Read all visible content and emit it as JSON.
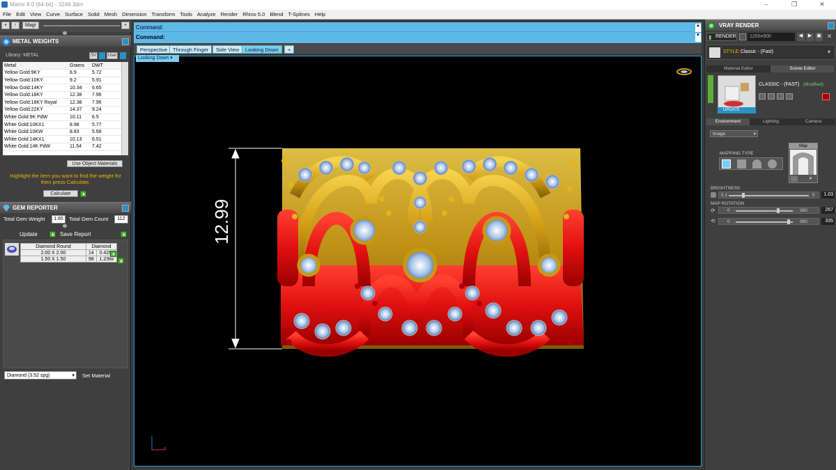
{
  "window": {
    "title": "Matrix 8.0 (64-bit) - 3249.3dm",
    "minimize": "–",
    "restore": "❐",
    "close": "✕"
  },
  "menu": [
    "File",
    "Edit",
    "View",
    "Curve",
    "Surface",
    "Solid",
    "Mesh",
    "Dimension",
    "Transform",
    "Tools",
    "Analyze",
    "Render",
    "Rhino 5.0",
    "Blend",
    "T-Splines",
    "Help"
  ],
  "left_toolbar": {
    "plus": "+",
    "up": "↑",
    "magic": "Magr",
    "expand": "+"
  },
  "metal_weights": {
    "title": "METAL WEIGHTS",
    "library_label": "Library: METAL",
    "sv_label": "SV",
    "user_label": "User",
    "columns": [
      "Metal",
      "Grams",
      "DWT"
    ],
    "rows": [
      [
        "Yellow Gold:9KY",
        "8.9",
        "5.72"
      ],
      [
        "Yellow Gold:10KY",
        "9.2",
        "5.91"
      ],
      [
        "Yellow Gold:14KY",
        "10.34",
        "6.65"
      ],
      [
        "Yellow Gold:18KY",
        "12.38",
        "7.96"
      ],
      [
        "Yellow Gold:18KY Royal",
        "12.38",
        "7.96"
      ],
      [
        "Yellow Gold:22KY",
        "14.37",
        "9.24"
      ],
      [
        "White Gold:9K PdW",
        "10.11",
        "6.5"
      ],
      [
        "White Gold:10KX1",
        "8.98",
        "5.77"
      ],
      [
        "White Gold:10KW",
        "8.83",
        "5.68"
      ],
      [
        "White Gold:14KX1",
        "10.13",
        "6.51"
      ],
      [
        "White Gold:14K PdW",
        "11.54",
        "7.42"
      ]
    ],
    "use_object_materials": "Use Object Materials",
    "hint": "Highlight the item you want to find the weight for then press Calculate.",
    "calculate": "Calculate"
  },
  "gem_reporter": {
    "title": "GEM REPORTER",
    "total_weight_label": "Total Gem Weight",
    "total_weight": "1.65",
    "total_count_label": "Total Gem Count",
    "total_count": "112",
    "update": "Update",
    "save_report": "Save Report",
    "columns": [
      "Diamond Round",
      "Diamond"
    ],
    "rows": [
      [
        "2.00 X 2.00",
        "14",
        "0.42tw"
      ],
      [
        "1.50 X 1.50",
        "98",
        "1.23tw"
      ]
    ],
    "material_select": "Diamond    (3.52 spg)",
    "set_material": "Set Material"
  },
  "command": {
    "line1": "Command:",
    "line2": "Command:"
  },
  "view_tabs": [
    "Perspective",
    "Through Finger",
    "Side View",
    "Looking Down",
    "+"
  ],
  "active_view": "Looking Down",
  "viewport": {
    "label": "Looking Down ▾",
    "dimension": "12.99",
    "axis_x": "x"
  },
  "vray": {
    "title": "VRAY RENDER",
    "render": "RENDER",
    "resolution": "1200x900",
    "style_label": "STYLE:",
    "style_value": "Classic - (Fast)",
    "tabs": [
      "Material Editor",
      "Scene Editor"
    ],
    "scene_name": "CLASSIC - (FAST)",
    "scene_status": "(Modified)",
    "update": "UPDATE",
    "env_tabs": [
      "Environment",
      "Lighting",
      "Camera"
    ],
    "env_select": "Image",
    "mapping_type": "MAPPING TYPE",
    "map_label": "Map",
    "brightness": {
      "label": "BRIGHTNESS",
      "min": "0.1",
      "max": "5",
      "value": "1.03",
      "level": 0.18
    },
    "map_rotation": {
      "label": "MAP ROTATION",
      "r1": {
        "min": "0",
        "max": "360",
        "value": "267",
        "level": 0.74
      },
      "r2": {
        "min": "0",
        "max": "360",
        "value": "335",
        "level": 0.93
      }
    }
  },
  "colors": {
    "accent": "#5fb9e6",
    "gold": "#d4a017",
    "red": "#e01010",
    "highlight": "#f0b400",
    "green": "#58b03a"
  }
}
